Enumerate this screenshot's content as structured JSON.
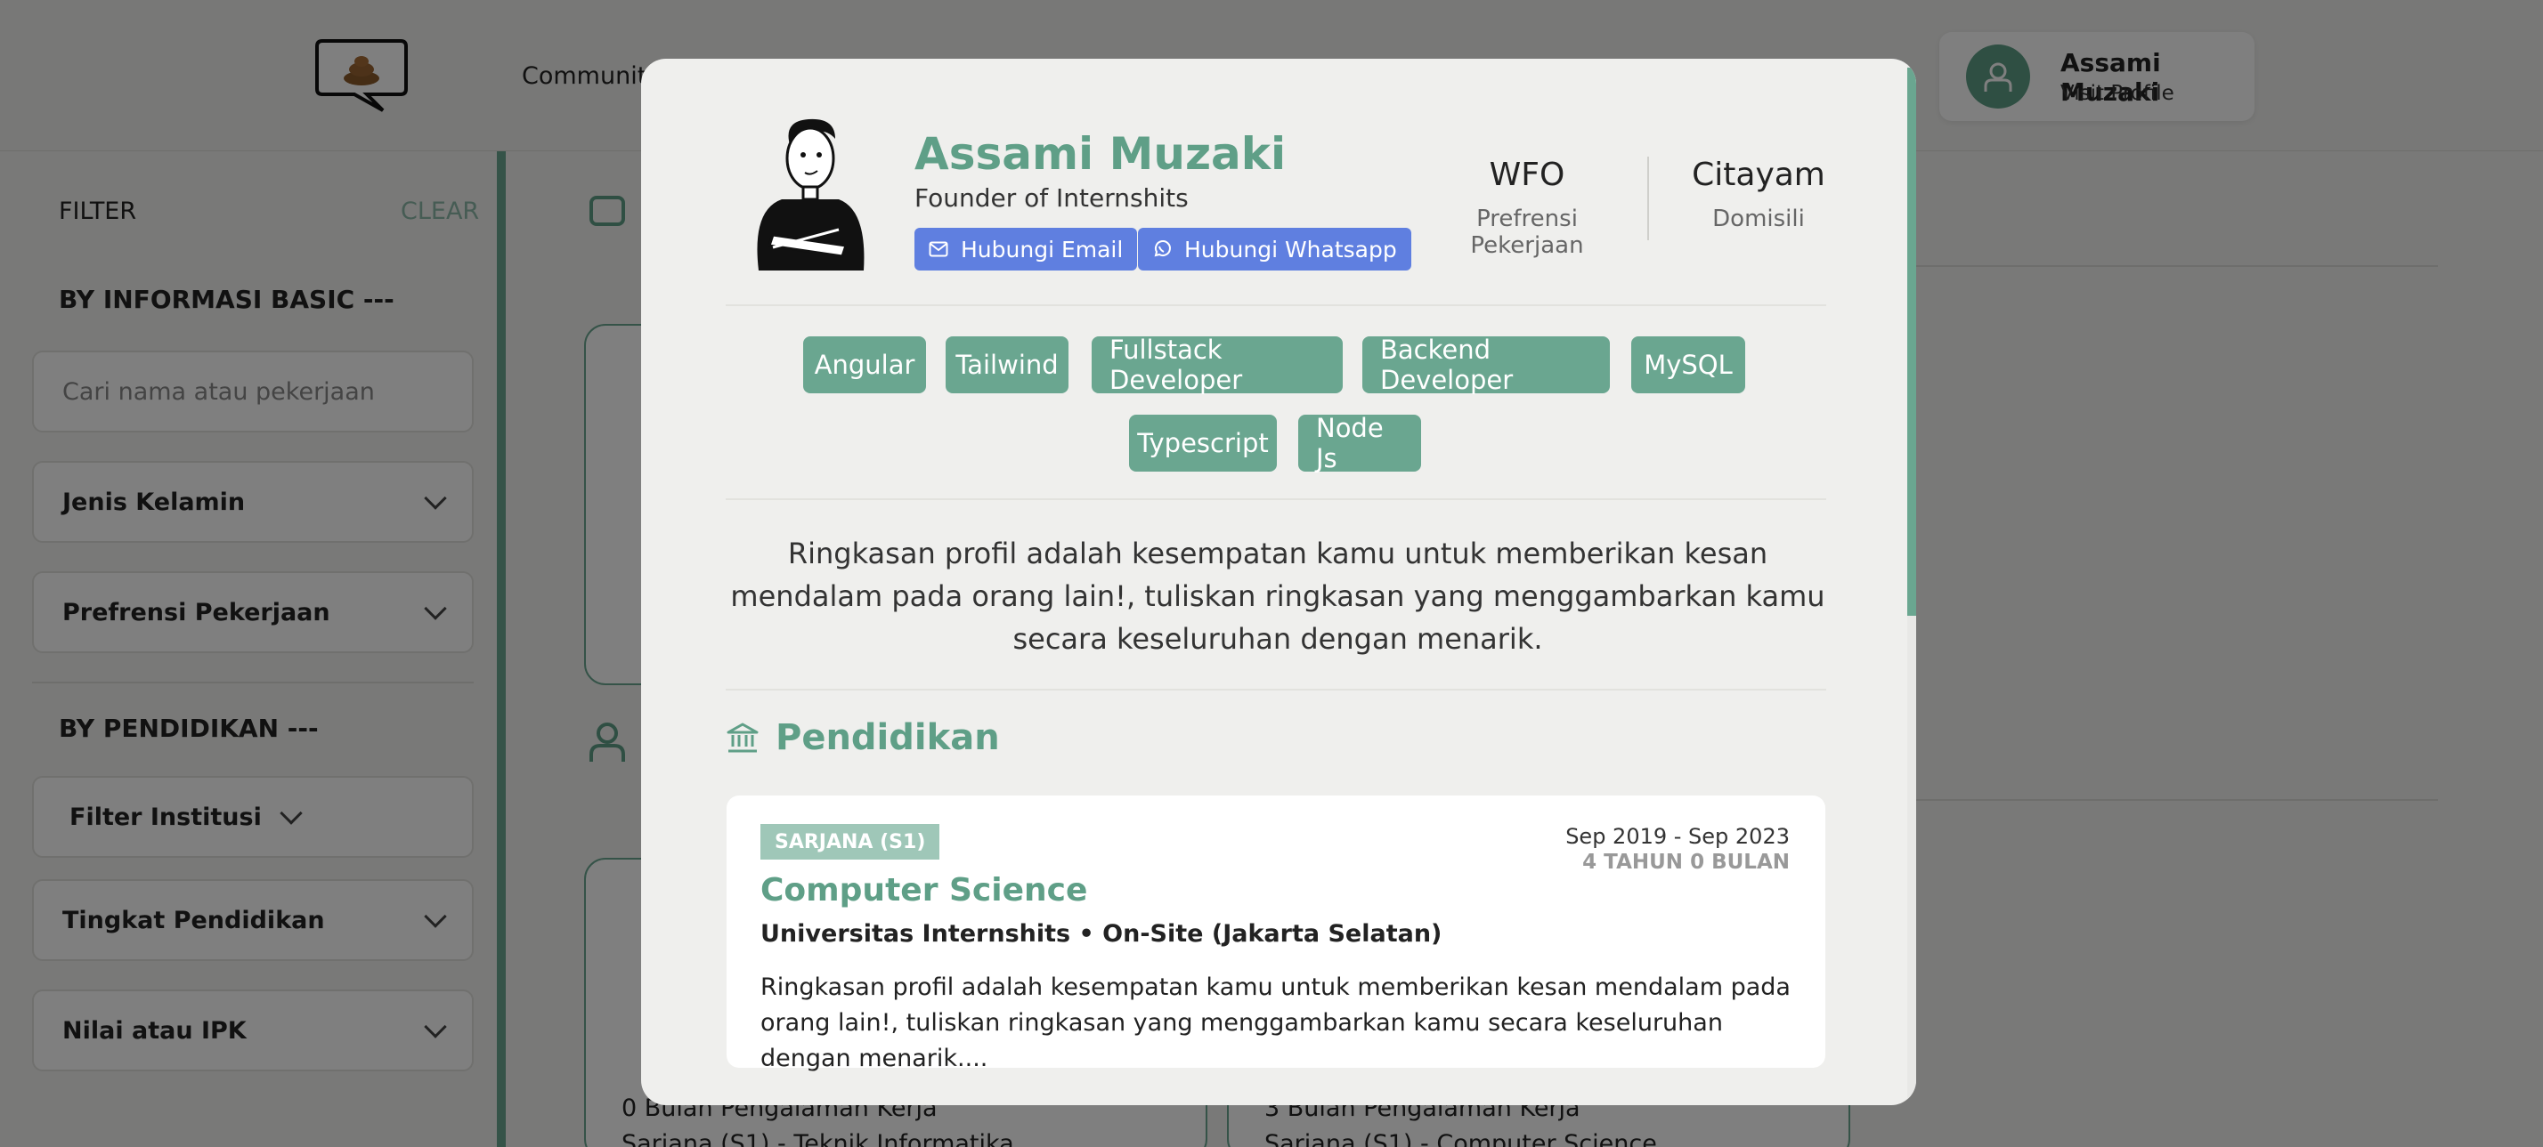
{
  "header": {
    "nav_community": "Communit",
    "user_name": "Assami Muzaki",
    "user_link": "Visit Profile"
  },
  "sidebar": {
    "filter_title": "FILTER",
    "clear_label": "CLEAR",
    "section_basic": "BY INFORMASI BASIC ---",
    "search_placeholder": "Cari nama atau pekerjaan",
    "gender_select": "Jenis Kelamin",
    "work_pref_select": "Prefrensi Pekerjaan",
    "section_edu": "BY PENDIDIKAN ---",
    "institution_filter": "Filter Institusi",
    "edu_level_select": "Tingkat Pendidikan",
    "gpa_select": "Nilai atau IPK"
  },
  "background_cards": {
    "left_exp": "0 Bulan Pengalaman Kerja",
    "left_edu": "Sarjana (S1) - Teknik Informatika",
    "right_exp": "3 Bulan Pengalaman Kerja",
    "right_edu": "Sarjana (S1) - Computer Science"
  },
  "modal": {
    "name": "Assami Muzaki",
    "role": "Founder of Internshits",
    "email_button": "Hubungi Email",
    "whatsapp_button": "Hubungi Whatsapp",
    "stats": [
      {
        "value": "WFO",
        "label": "Prefrensi Pekerjaan"
      },
      {
        "value": "Citayam",
        "label": "Domisili"
      }
    ],
    "skills": [
      "Angular",
      "Tailwind",
      "Fullstack Developer",
      "Backend Developer",
      "MySQL",
      "Typescript",
      "Node Js"
    ],
    "summary": "Ringkasan profil adalah kesempatan kamu untuk memberikan kesan mendalam pada orang lain!, tuliskan ringkasan yang menggambarkan kamu secara keseluruhan dengan menarik.",
    "education_heading": "Pendidikan",
    "education": {
      "degree_badge": "SARJANA (S1)",
      "major": "Computer Science",
      "institution": "Universitas Internshits • On-Site (Jakarta Selatan)",
      "date_range": "Sep 2019 - Sep 2023",
      "duration": "4 TAHUN 0 BULAN",
      "description": "Ringkasan profil adalah kesempatan kamu untuk memberikan kesan mendalam pada orang lain!, tuliskan ringkasan yang menggambarkan kamu secara keseluruhan dengan menarik...."
    }
  },
  "colors": {
    "accent": "#6aa690",
    "button_blue": "#5f7fe0",
    "overlay": "rgba(0,0,0,0.5)"
  }
}
